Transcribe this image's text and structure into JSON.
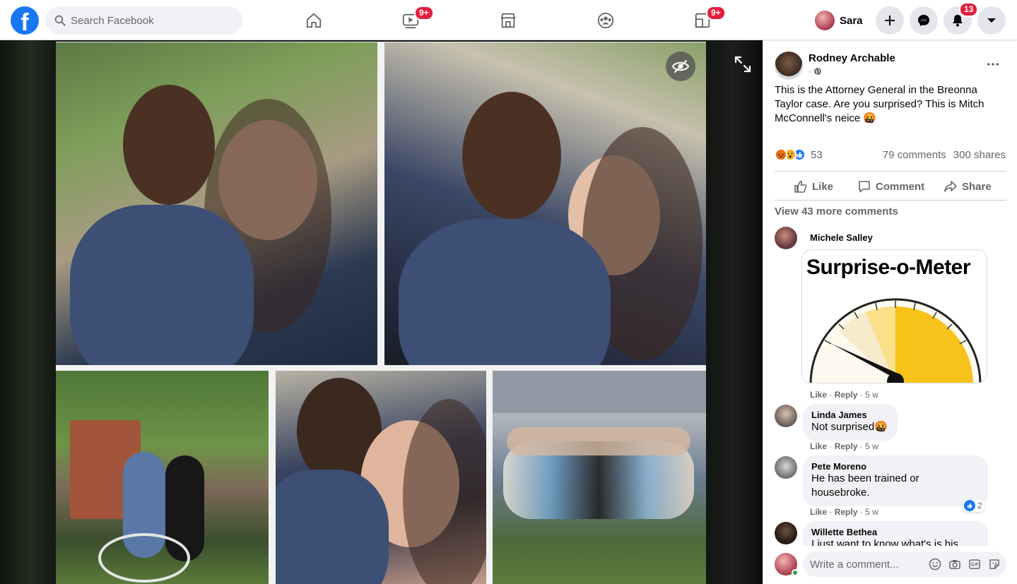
{
  "topbar": {
    "logo": "f",
    "search_placeholder": "Search Facebook",
    "tabs": [
      {
        "name": "home",
        "icon": "home-icon",
        "badge": ""
      },
      {
        "name": "watch",
        "icon": "video-icon",
        "badge": "9+"
      },
      {
        "name": "marketplace",
        "icon": "shop-icon",
        "badge": ""
      },
      {
        "name": "groups",
        "icon": "groups-icon",
        "badge": ""
      },
      {
        "name": "gaming",
        "icon": "gaming-icon",
        "badge": "9+"
      }
    ],
    "profile_name": "Sara",
    "notifications_badge": "13",
    "brand_color": "#1877f2",
    "badge_color": "#e41e3f"
  },
  "post": {
    "author": "Rodney Archable",
    "meta_dot": "·",
    "text": "This is the Attorney General in the Breonna Taylor case. Are you surprised? This is Mitch McConnell's neice 🤬",
    "reaction_count": "53",
    "comments_count": "79 comments",
    "shares_count": "300 shares",
    "actions": {
      "like": "Like",
      "comment": "Comment",
      "share": "Share"
    },
    "view_more": "View 43 more comments"
  },
  "comments": [
    {
      "name": "Michele Salley",
      "text": "",
      "sticker_title": "Surprise-o-Meter",
      "like": "Like",
      "reply": "Reply",
      "time": "5 w",
      "likes": ""
    },
    {
      "name": "Linda James",
      "text": "Not surprised🤬",
      "like": "Like",
      "reply": "Reply",
      "time": "5 w",
      "likes": ""
    },
    {
      "name": "Pete Moreno",
      "text": "He has been trained or housebroke.",
      "like": "Like",
      "reply": "Reply",
      "time": "5 w",
      "likes": "2"
    },
    {
      "name": "Willette Bethea",
      "text": "I just want to know what's is his",
      "like": "",
      "reply": "",
      "time": "",
      "likes": ""
    }
  ],
  "composer": {
    "placeholder": "Write a comment...",
    "icons": [
      "emoji-icon",
      "camera-icon",
      "gif-icon",
      "sticker-icon"
    ]
  },
  "meta_sep": "·"
}
